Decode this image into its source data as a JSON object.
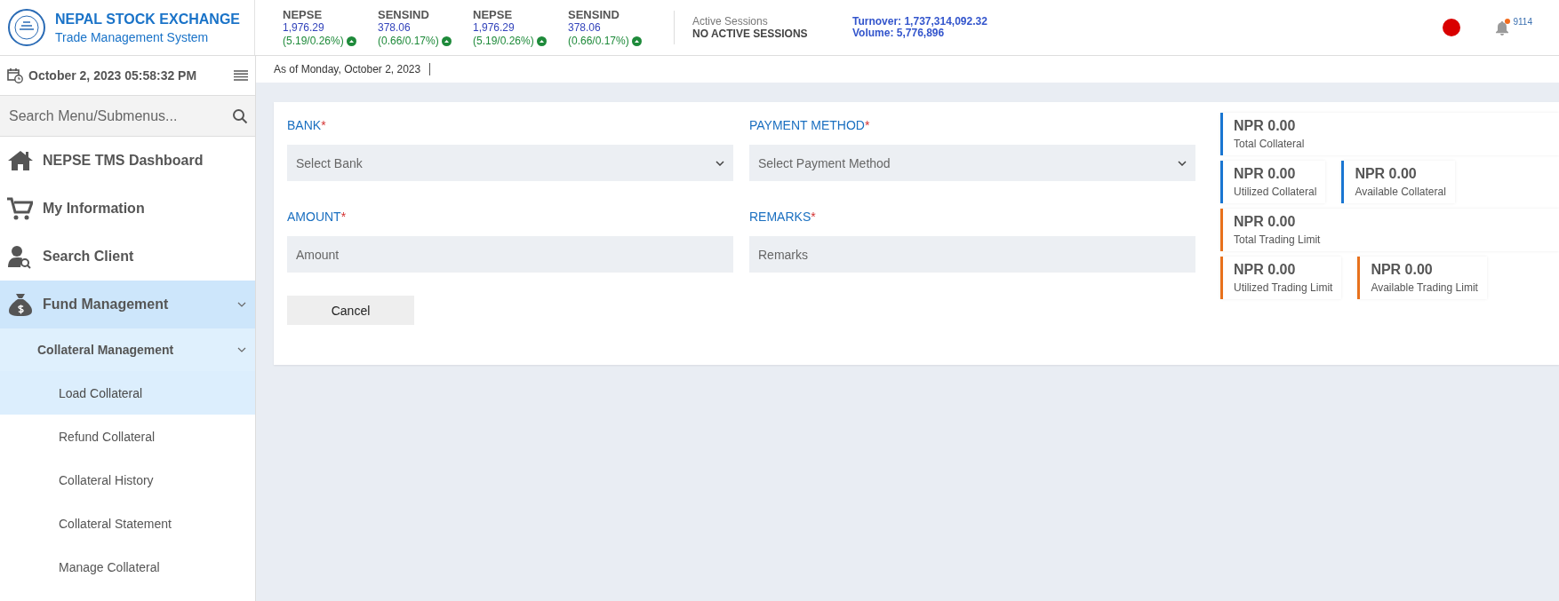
{
  "header": {
    "logo_title": "NEPAL STOCK EXCHANGE",
    "logo_subtitle": "Trade Management System",
    "indices": [
      {
        "name": "NEPSE",
        "value": "1,976.29",
        "change": "(5.19/0.26%)"
      },
      {
        "name": "SENSIND",
        "value": "378.06",
        "change": "(0.66/0.17%)"
      },
      {
        "name": "NEPSE",
        "value": "1,976.29",
        "change": "(5.19/0.26%)"
      },
      {
        "name": "SENSIND",
        "value": "378.06",
        "change": "(0.66/0.17%)"
      }
    ],
    "sessions": {
      "label": "Active Sessions",
      "value": "NO ACTIVE SESSIONS"
    },
    "turnover": "Turnover: 1,737,314,092.32",
    "volume": "Volume: 5,776,896",
    "notification_count": "9114"
  },
  "sidebar": {
    "datetime": "October 2, 2023 05:58:32 PM",
    "search": {
      "placeholder": "Search Menu/Submenus..."
    },
    "items": [
      {
        "label": "NEPSE TMS Dashboard",
        "selected": false
      },
      {
        "label": "My Information",
        "selected": false
      },
      {
        "label": "Search Client",
        "selected": false
      },
      {
        "label": "Fund Management",
        "selected": false,
        "expanded": true,
        "children": [
          {
            "label": "Collateral Management",
            "selected": false,
            "expanded": true,
            "children": [
              {
                "label": "Load Collateral",
                "selected": true
              },
              {
                "label": "Refund Collateral",
                "selected": false
              },
              {
                "label": "Collateral History",
                "selected": false
              },
              {
                "label": "Collateral Statement",
                "selected": false
              },
              {
                "label": "Manage Collateral",
                "selected": false
              }
            ]
          }
        ]
      }
    ]
  },
  "breadcrumb": "As of Monday, October 2, 2023",
  "form": {
    "fields": [
      {
        "kind": "select",
        "label": "BANK",
        "required_mark": "*",
        "placeholder": "Select Bank"
      },
      {
        "kind": "select",
        "label": "PAYMENT METHOD",
        "required_mark": "*",
        "placeholder": "Select Payment Method"
      },
      {
        "kind": "input",
        "label": "AMOUNT",
        "required_mark": "*",
        "placeholder": "Amount"
      },
      {
        "kind": "input",
        "label": "REMARKS",
        "required_mark": "*",
        "placeholder": "Remarks"
      }
    ],
    "buttons": [
      "Cancel"
    ]
  },
  "summary": [
    {
      "cards": [
        {
          "amount": "NPR 0.00",
          "label": "Total Collateral",
          "color": "#1976d2"
        }
      ]
    },
    {
      "cards": [
        {
          "amount": "NPR 0.00",
          "label": "Utilized Collateral",
          "color": "#1976d2"
        },
        {
          "amount": "NPR 0.00",
          "label": "Available Collateral",
          "color": "#1976d2"
        }
      ]
    },
    {
      "cards": [
        {
          "amount": "NPR 0.00",
          "label": "Total Trading Limit",
          "color": "#e8711c"
        }
      ]
    },
    {
      "cards": [
        {
          "amount": "NPR 0.00",
          "label": "Utilized Trading Limit",
          "color": "#e8711c"
        },
        {
          "amount": "NPR 0.00",
          "label": "Available Trading Limit",
          "color": "#e8711c"
        }
      ]
    }
  ]
}
